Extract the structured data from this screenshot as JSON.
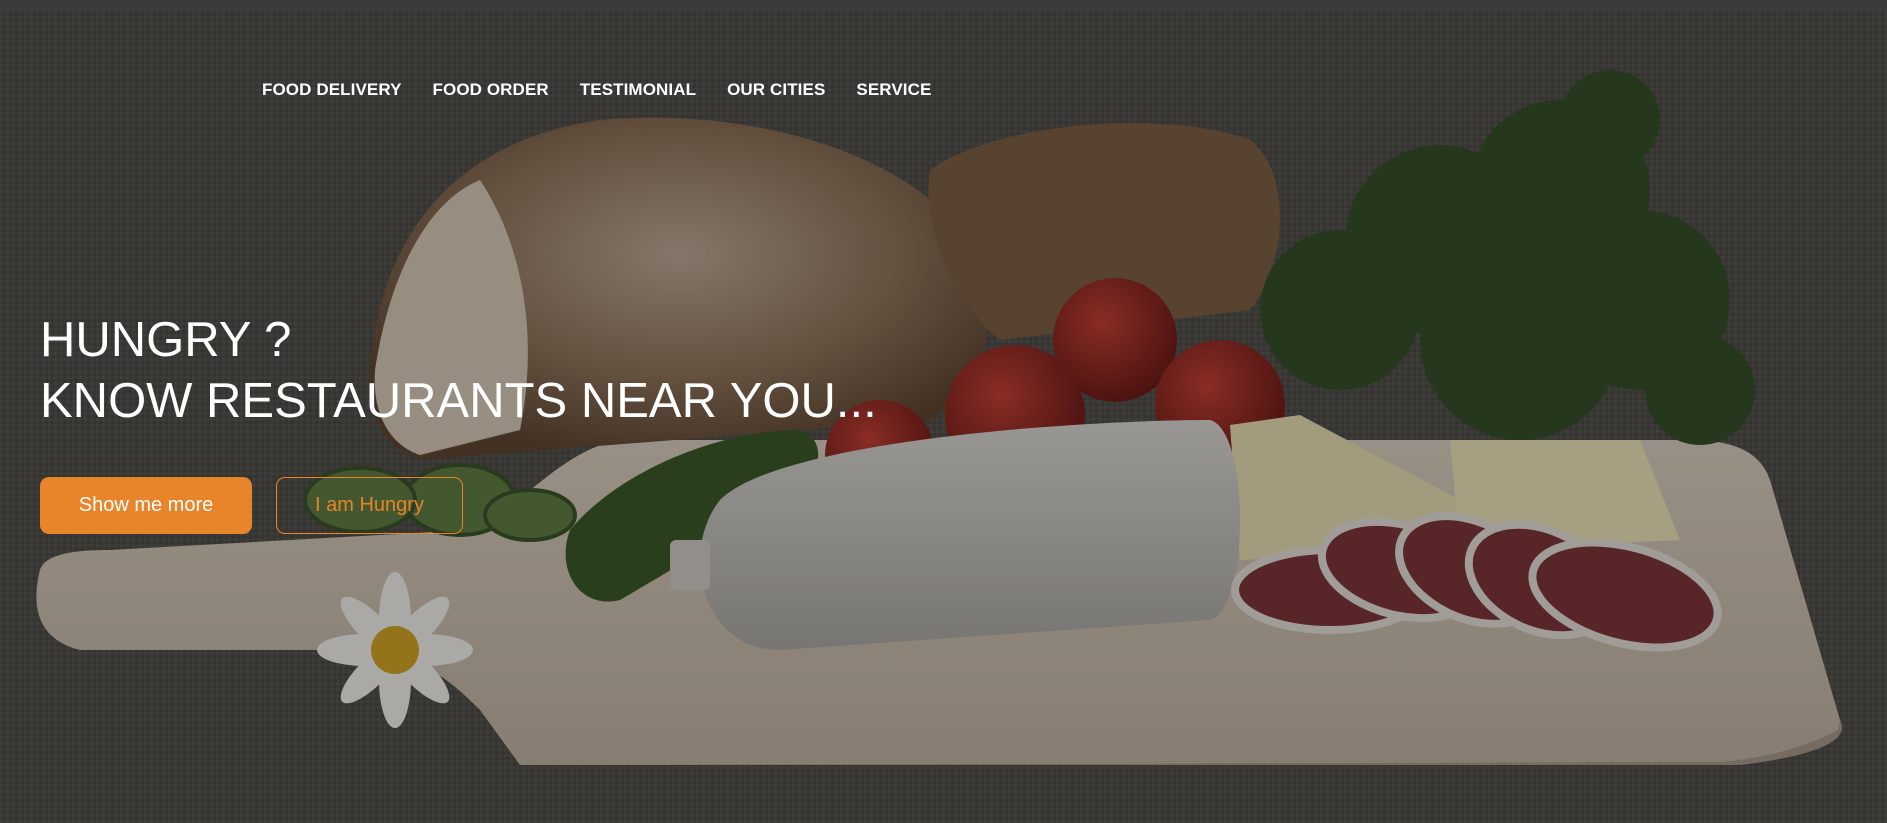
{
  "nav": {
    "items": [
      {
        "label": "FOOD DELIVERY"
      },
      {
        "label": "FOOD ORDER"
      },
      {
        "label": "TESTIMONIAL"
      },
      {
        "label": "OUR CITIES"
      },
      {
        "label": "SERVICE"
      }
    ]
  },
  "hero": {
    "headline_line1": "HUNGRY ?",
    "headline_line2": "KNOW RESTAURANTS NEAR YOU...",
    "primary_button": "Show me more",
    "secondary_button": "I am Hungry"
  },
  "colors": {
    "accent": "#e8842a",
    "text": "#ffffff"
  }
}
